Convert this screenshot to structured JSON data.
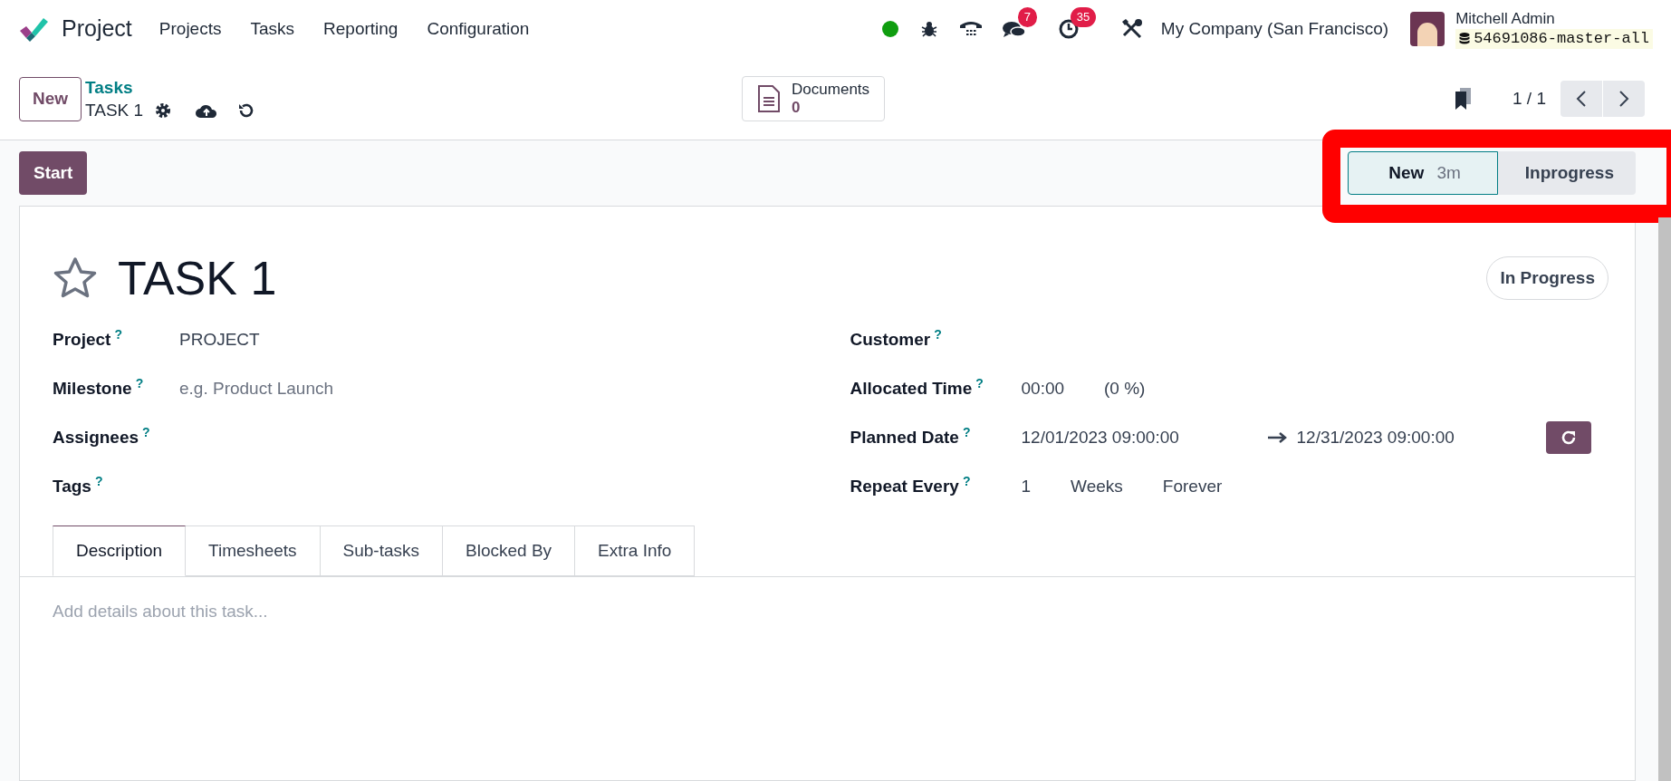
{
  "navbar": {
    "app_name": "Project",
    "menu": [
      "Projects",
      "Tasks",
      "Reporting",
      "Configuration"
    ],
    "messages_count": "7",
    "activities_count": "35",
    "company": "My Company (San Francisco)",
    "user_name": "Mitchell Admin",
    "database": "54691086-master-all"
  },
  "control_panel": {
    "new_button": "New",
    "breadcrumb_parent": "Tasks",
    "breadcrumb_current": "TASK 1",
    "documents_label": "Documents",
    "documents_count": "0",
    "pager": "1 / 1"
  },
  "status_bar": {
    "action_button": "Start",
    "stages": [
      {
        "label": "New",
        "duration": "3m",
        "selected": true
      },
      {
        "label": "Inprogress",
        "selected": false
      }
    ],
    "highlighted": true
  },
  "form": {
    "title": "TASK 1",
    "starred": false,
    "state_button": "In Progress",
    "left_fields": [
      {
        "label": "Project",
        "help": "?",
        "kind": "value",
        "value": "PROJECT"
      },
      {
        "label": "Milestone",
        "help": "?",
        "kind": "placeholder",
        "value": "e.g. Product Launch"
      },
      {
        "label": "Assignees",
        "help": "?",
        "kind": "empty"
      },
      {
        "label": "Tags",
        "help": "?",
        "kind": "empty"
      }
    ],
    "right_fields": [
      {
        "label": "Customer",
        "help": "?",
        "kind": "empty"
      },
      {
        "label": "Allocated Time",
        "help": "?",
        "kind": "parts",
        "parts": [
          "00:00",
          "(0 %)"
        ]
      },
      {
        "label": "Planned Date",
        "help": "?",
        "kind": "date_range",
        "parts": [
          "12/01/2023 09:00:00",
          "12/31/2023 09:00:00"
        ]
      },
      {
        "label": "Repeat Every",
        "help": "?",
        "kind": "parts",
        "parts": [
          "1",
          "Weeks",
          "Forever"
        ]
      }
    ],
    "tabs": [
      {
        "label": "Description",
        "selected": true
      },
      {
        "label": "Timesheets",
        "selected": false
      },
      {
        "label": "Sub-tasks",
        "selected": false
      },
      {
        "label": "Blocked By",
        "selected": false
      },
      {
        "label": "Extra Info",
        "selected": false
      }
    ],
    "description_placeholder": "Add details about this task..."
  }
}
